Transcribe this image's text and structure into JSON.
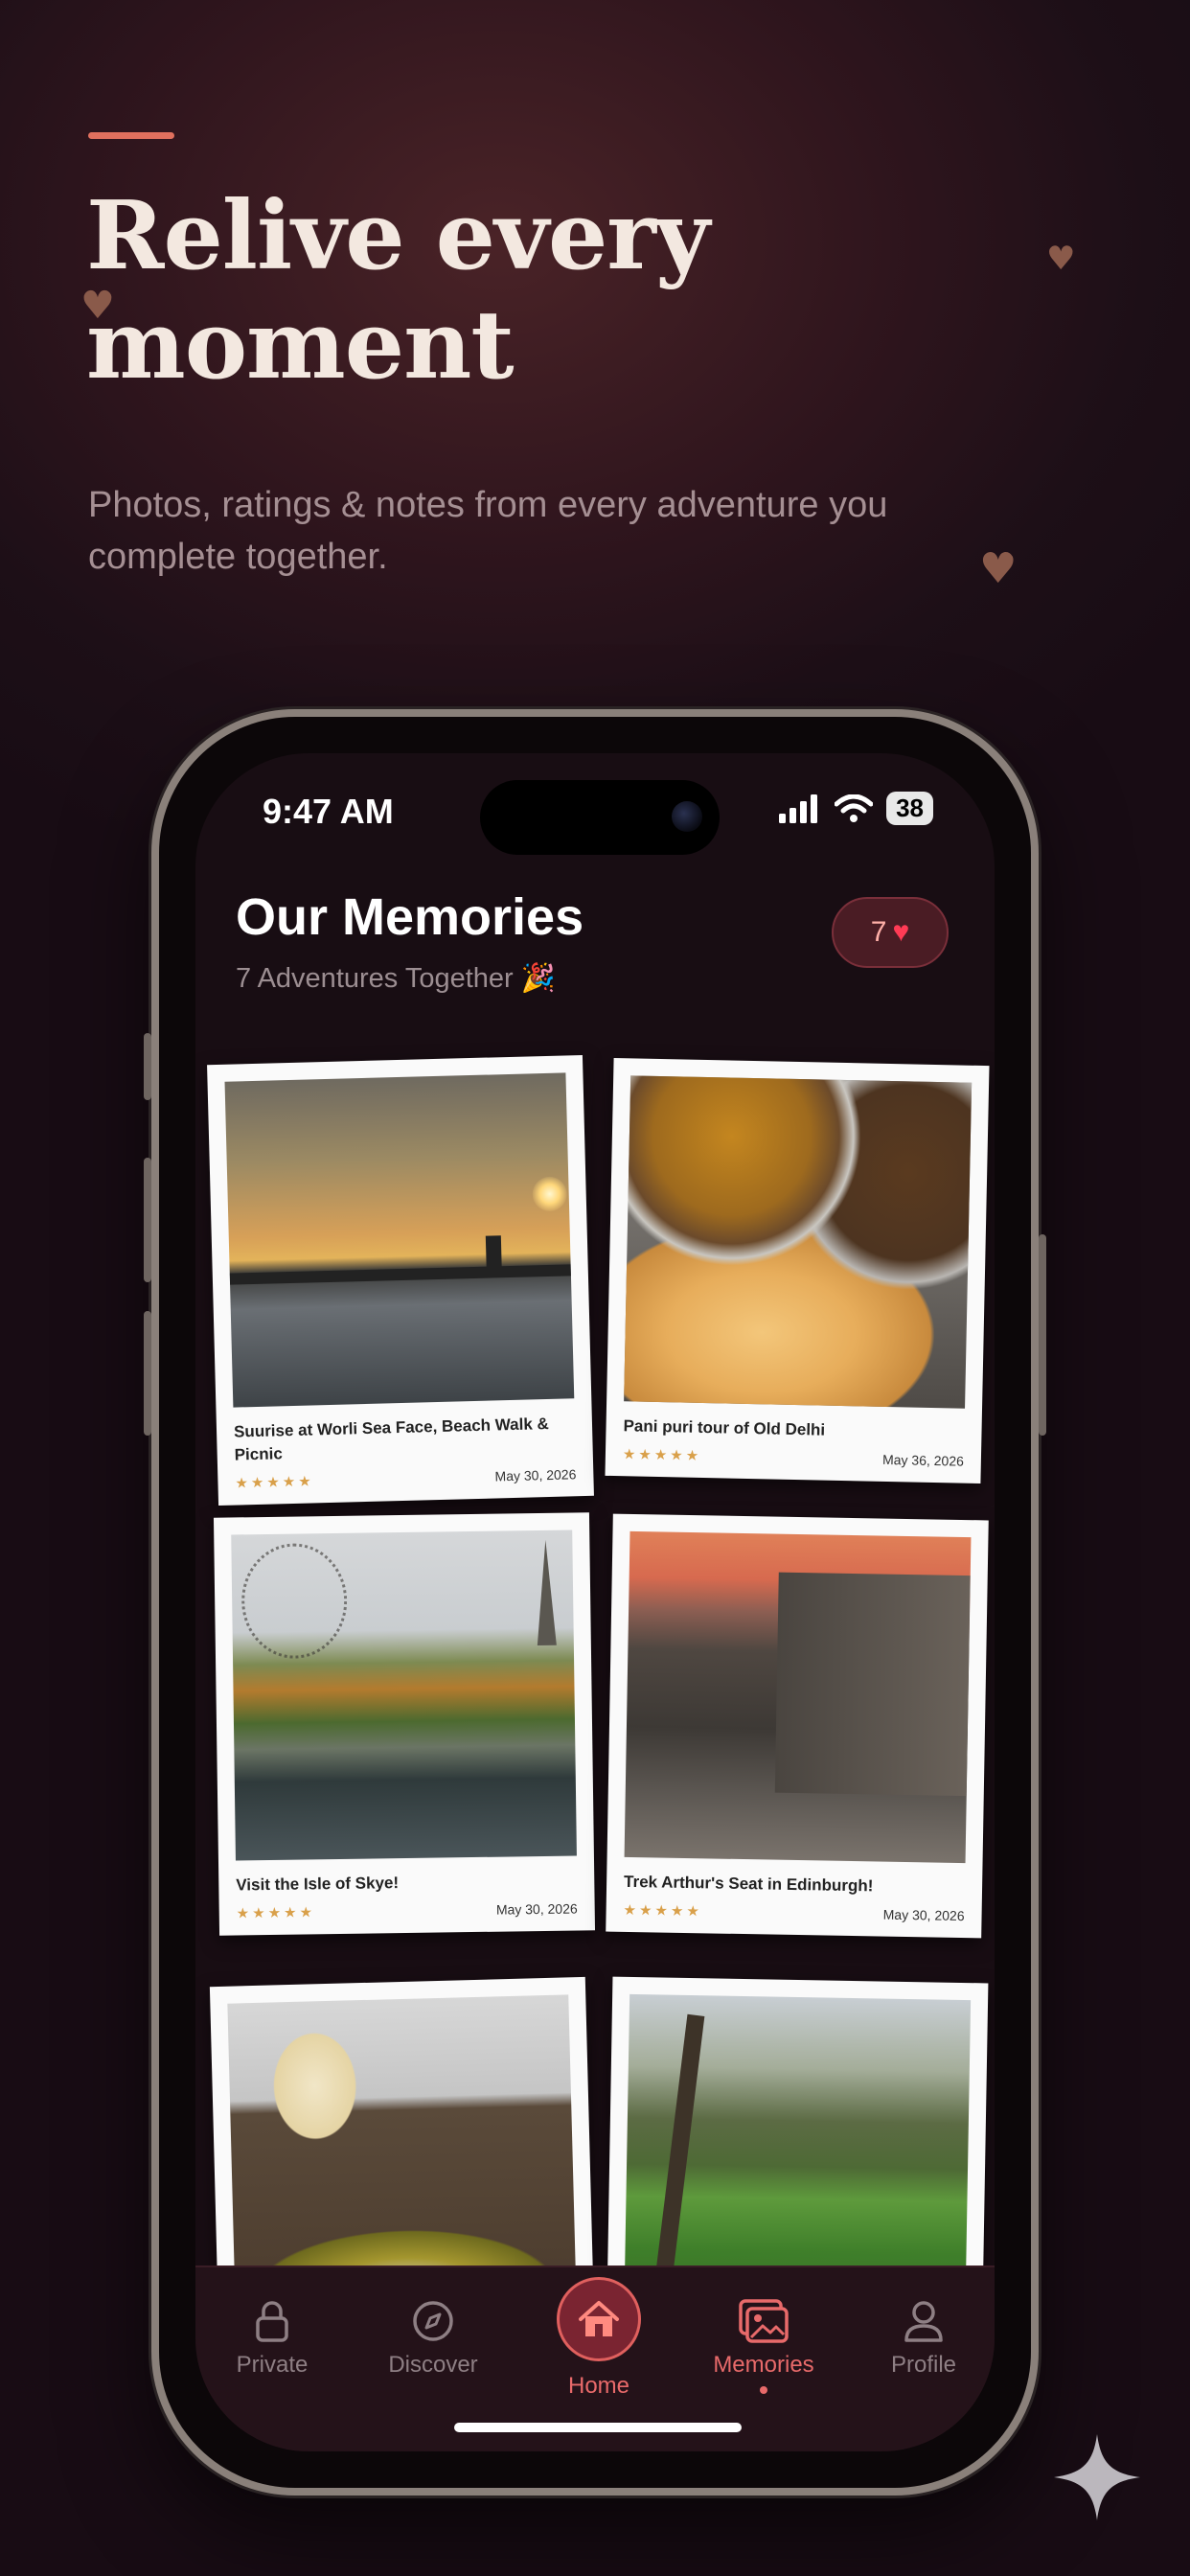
{
  "hero": {
    "headline": "Relive every moment",
    "subtitle": "Photos, ratings & notes from every adventure you complete together."
  },
  "status_bar": {
    "time": "9:47 AM",
    "battery": "38"
  },
  "header": {
    "title": "Our Memories",
    "subtitle": "7 Adventures Together 🎉",
    "count": "7",
    "count_icon": "heart-icon"
  },
  "memories": [
    {
      "caption": "Suurise at Worli Sea Face, Beach Walk & Picnic",
      "date": "May 30, 2026",
      "rating": 5
    },
    {
      "caption": "Pani puri tour of Old Delhi",
      "date": "May 36, 2026",
      "rating": 5
    },
    {
      "caption": "Visit the Isle of Skye!",
      "date": "May 30, 2026",
      "rating": 5
    },
    {
      "caption": "Trek Arthur's Seat in Edinburgh!",
      "date": "May 30, 2026",
      "rating": 5
    },
    {
      "caption": "",
      "date": "",
      "rating": 0
    },
    {
      "caption": "",
      "date": "",
      "rating": 0
    }
  ],
  "tabs": [
    {
      "label": "Private",
      "icon": "lock-icon"
    },
    {
      "label": "Discover",
      "icon": "compass-icon"
    },
    {
      "label": "Home",
      "icon": "home-icon"
    },
    {
      "label": "Memories",
      "icon": "photos-icon"
    },
    {
      "label": "Profile",
      "icon": "person-icon"
    }
  ],
  "colors": {
    "accent": "#e86a6a",
    "background": "#1d0f17",
    "star": "#d9a04a"
  },
  "stars_text": "★★★★★"
}
